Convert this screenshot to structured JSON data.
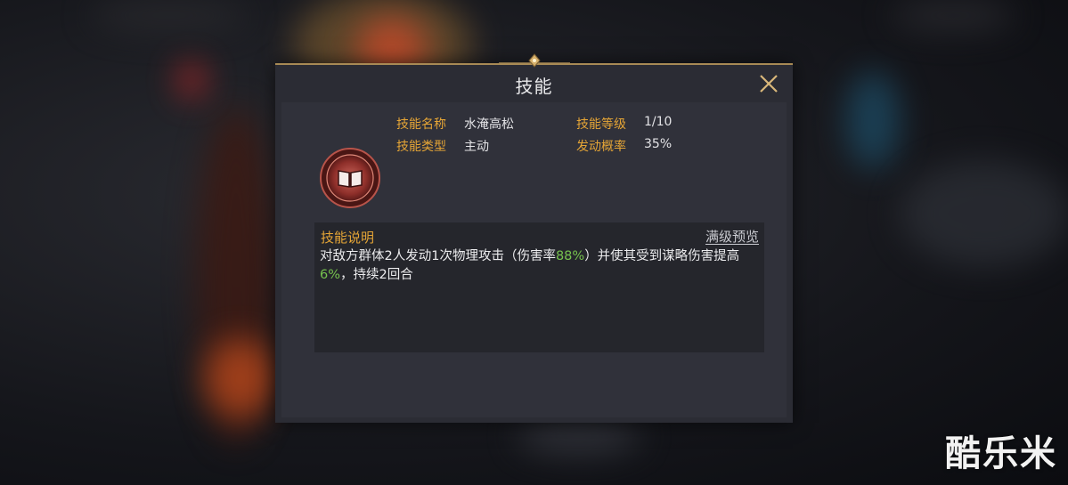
{
  "dialog": {
    "title": "技能",
    "close_icon": "close-icon",
    "skill_icon": "skill-book-icon",
    "fields": {
      "name_label": "技能名称",
      "name_value": "水淹高松",
      "level_label": "技能等级",
      "level_value": "1/10",
      "type_label": "技能类型",
      "type_value": "主动",
      "rate_label": "发动概率",
      "rate_value": "35%"
    },
    "description": {
      "title": "技能说明",
      "preview_link": "满级预览",
      "part1": "对敌方群体2人发动1次物理攻击（伤害率",
      "hl1": "88%",
      "part2": "）并使其受到谋略伤害提高",
      "hl2": "6%",
      "part3": "，持续2回合"
    }
  },
  "watermark": "酷乐米",
  "colors": {
    "label": "#e5a536",
    "highlight": "#76c24e",
    "frame_gold": "#a88a55",
    "panel": "#2b2c34"
  }
}
